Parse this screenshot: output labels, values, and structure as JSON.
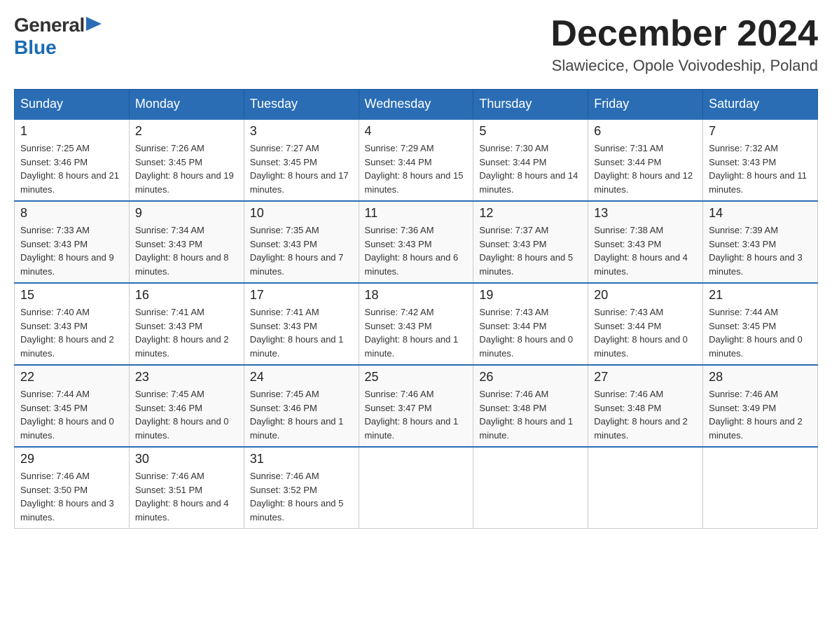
{
  "header": {
    "logo_general": "General",
    "logo_blue": "Blue",
    "month_title": "December 2024",
    "subtitle": "Slawiecice, Opole Voivodeship, Poland"
  },
  "days_of_week": [
    "Sunday",
    "Monday",
    "Tuesday",
    "Wednesday",
    "Thursday",
    "Friday",
    "Saturday"
  ],
  "weeks": [
    {
      "days": [
        {
          "num": "1",
          "sunrise": "7:25 AM",
          "sunset": "3:46 PM",
          "daylight": "8 hours and 21 minutes."
        },
        {
          "num": "2",
          "sunrise": "7:26 AM",
          "sunset": "3:45 PM",
          "daylight": "8 hours and 19 minutes."
        },
        {
          "num": "3",
          "sunrise": "7:27 AM",
          "sunset": "3:45 PM",
          "daylight": "8 hours and 17 minutes."
        },
        {
          "num": "4",
          "sunrise": "7:29 AM",
          "sunset": "3:44 PM",
          "daylight": "8 hours and 15 minutes."
        },
        {
          "num": "5",
          "sunrise": "7:30 AM",
          "sunset": "3:44 PM",
          "daylight": "8 hours and 14 minutes."
        },
        {
          "num": "6",
          "sunrise": "7:31 AM",
          "sunset": "3:44 PM",
          "daylight": "8 hours and 12 minutes."
        },
        {
          "num": "7",
          "sunrise": "7:32 AM",
          "sunset": "3:43 PM",
          "daylight": "8 hours and 11 minutes."
        }
      ]
    },
    {
      "days": [
        {
          "num": "8",
          "sunrise": "7:33 AM",
          "sunset": "3:43 PM",
          "daylight": "8 hours and 9 minutes."
        },
        {
          "num": "9",
          "sunrise": "7:34 AM",
          "sunset": "3:43 PM",
          "daylight": "8 hours and 8 minutes."
        },
        {
          "num": "10",
          "sunrise": "7:35 AM",
          "sunset": "3:43 PM",
          "daylight": "8 hours and 7 minutes."
        },
        {
          "num": "11",
          "sunrise": "7:36 AM",
          "sunset": "3:43 PM",
          "daylight": "8 hours and 6 minutes."
        },
        {
          "num": "12",
          "sunrise": "7:37 AM",
          "sunset": "3:43 PM",
          "daylight": "8 hours and 5 minutes."
        },
        {
          "num": "13",
          "sunrise": "7:38 AM",
          "sunset": "3:43 PM",
          "daylight": "8 hours and 4 minutes."
        },
        {
          "num": "14",
          "sunrise": "7:39 AM",
          "sunset": "3:43 PM",
          "daylight": "8 hours and 3 minutes."
        }
      ]
    },
    {
      "days": [
        {
          "num": "15",
          "sunrise": "7:40 AM",
          "sunset": "3:43 PM",
          "daylight": "8 hours and 2 minutes."
        },
        {
          "num": "16",
          "sunrise": "7:41 AM",
          "sunset": "3:43 PM",
          "daylight": "8 hours and 2 minutes."
        },
        {
          "num": "17",
          "sunrise": "7:41 AM",
          "sunset": "3:43 PM",
          "daylight": "8 hours and 1 minute."
        },
        {
          "num": "18",
          "sunrise": "7:42 AM",
          "sunset": "3:43 PM",
          "daylight": "8 hours and 1 minute."
        },
        {
          "num": "19",
          "sunrise": "7:43 AM",
          "sunset": "3:44 PM",
          "daylight": "8 hours and 0 minutes."
        },
        {
          "num": "20",
          "sunrise": "7:43 AM",
          "sunset": "3:44 PM",
          "daylight": "8 hours and 0 minutes."
        },
        {
          "num": "21",
          "sunrise": "7:44 AM",
          "sunset": "3:45 PM",
          "daylight": "8 hours and 0 minutes."
        }
      ]
    },
    {
      "days": [
        {
          "num": "22",
          "sunrise": "7:44 AM",
          "sunset": "3:45 PM",
          "daylight": "8 hours and 0 minutes."
        },
        {
          "num": "23",
          "sunrise": "7:45 AM",
          "sunset": "3:46 PM",
          "daylight": "8 hours and 0 minutes."
        },
        {
          "num": "24",
          "sunrise": "7:45 AM",
          "sunset": "3:46 PM",
          "daylight": "8 hours and 1 minute."
        },
        {
          "num": "25",
          "sunrise": "7:46 AM",
          "sunset": "3:47 PM",
          "daylight": "8 hours and 1 minute."
        },
        {
          "num": "26",
          "sunrise": "7:46 AM",
          "sunset": "3:48 PM",
          "daylight": "8 hours and 1 minute."
        },
        {
          "num": "27",
          "sunrise": "7:46 AM",
          "sunset": "3:48 PM",
          "daylight": "8 hours and 2 minutes."
        },
        {
          "num": "28",
          "sunrise": "7:46 AM",
          "sunset": "3:49 PM",
          "daylight": "8 hours and 2 minutes."
        }
      ]
    },
    {
      "days": [
        {
          "num": "29",
          "sunrise": "7:46 AM",
          "sunset": "3:50 PM",
          "daylight": "8 hours and 3 minutes."
        },
        {
          "num": "30",
          "sunrise": "7:46 AM",
          "sunset": "3:51 PM",
          "daylight": "8 hours and 4 minutes."
        },
        {
          "num": "31",
          "sunrise": "7:46 AM",
          "sunset": "3:52 PM",
          "daylight": "8 hours and 5 minutes."
        },
        null,
        null,
        null,
        null
      ]
    }
  ]
}
